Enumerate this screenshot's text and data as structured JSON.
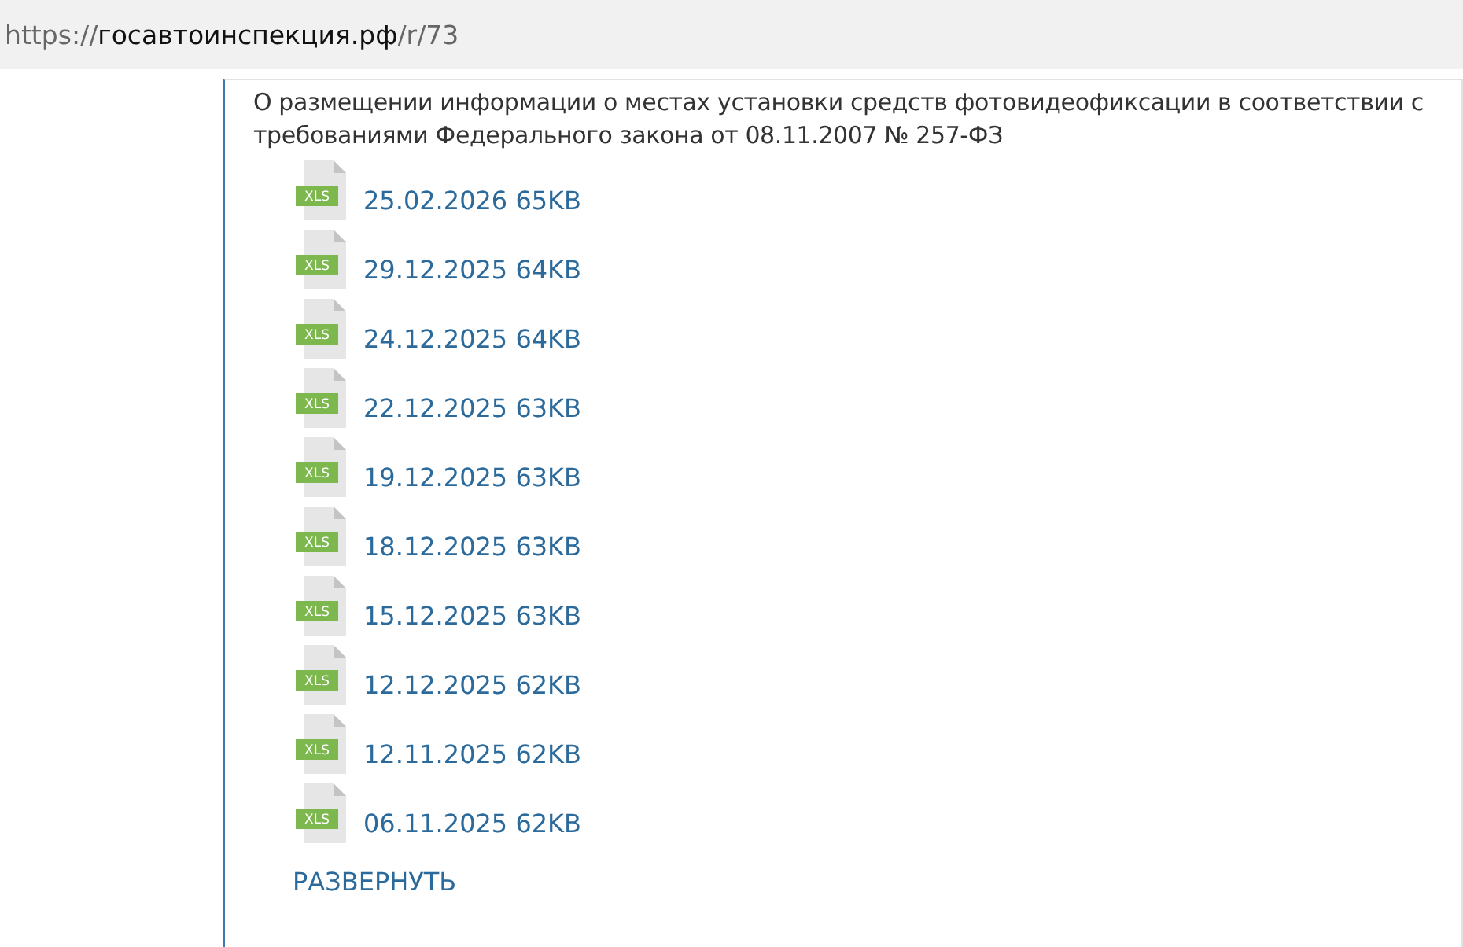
{
  "address_bar": {
    "scheme": "https://",
    "host": "госавтоинспекция.рф",
    "path": "/r/73"
  },
  "description": "О размещении информации о местах установки средств фотовидеофиксации в соответствии с требованиями Федерального закона от 08.11.2007 № 257-ФЗ",
  "files": [
    {
      "badge": "XLS",
      "label": "25.02.2026 65KB"
    },
    {
      "badge": "XLS",
      "label": "29.12.2025 64KB"
    },
    {
      "badge": "XLS",
      "label": "24.12.2025 64KB"
    },
    {
      "badge": "XLS",
      "label": "22.12.2025 63KB"
    },
    {
      "badge": "XLS",
      "label": "19.12.2025 63KB"
    },
    {
      "badge": "XLS",
      "label": "18.12.2025 63KB"
    },
    {
      "badge": "XLS",
      "label": "15.12.2025 63KB"
    },
    {
      "badge": "XLS",
      "label": "12.12.2025 62KB"
    },
    {
      "badge": "XLS",
      "label": "12.11.2025 62KB"
    },
    {
      "badge": "XLS",
      "label": "06.11.2025 62KB"
    }
  ],
  "expand_link": "РАЗВЕРНУТЬ"
}
